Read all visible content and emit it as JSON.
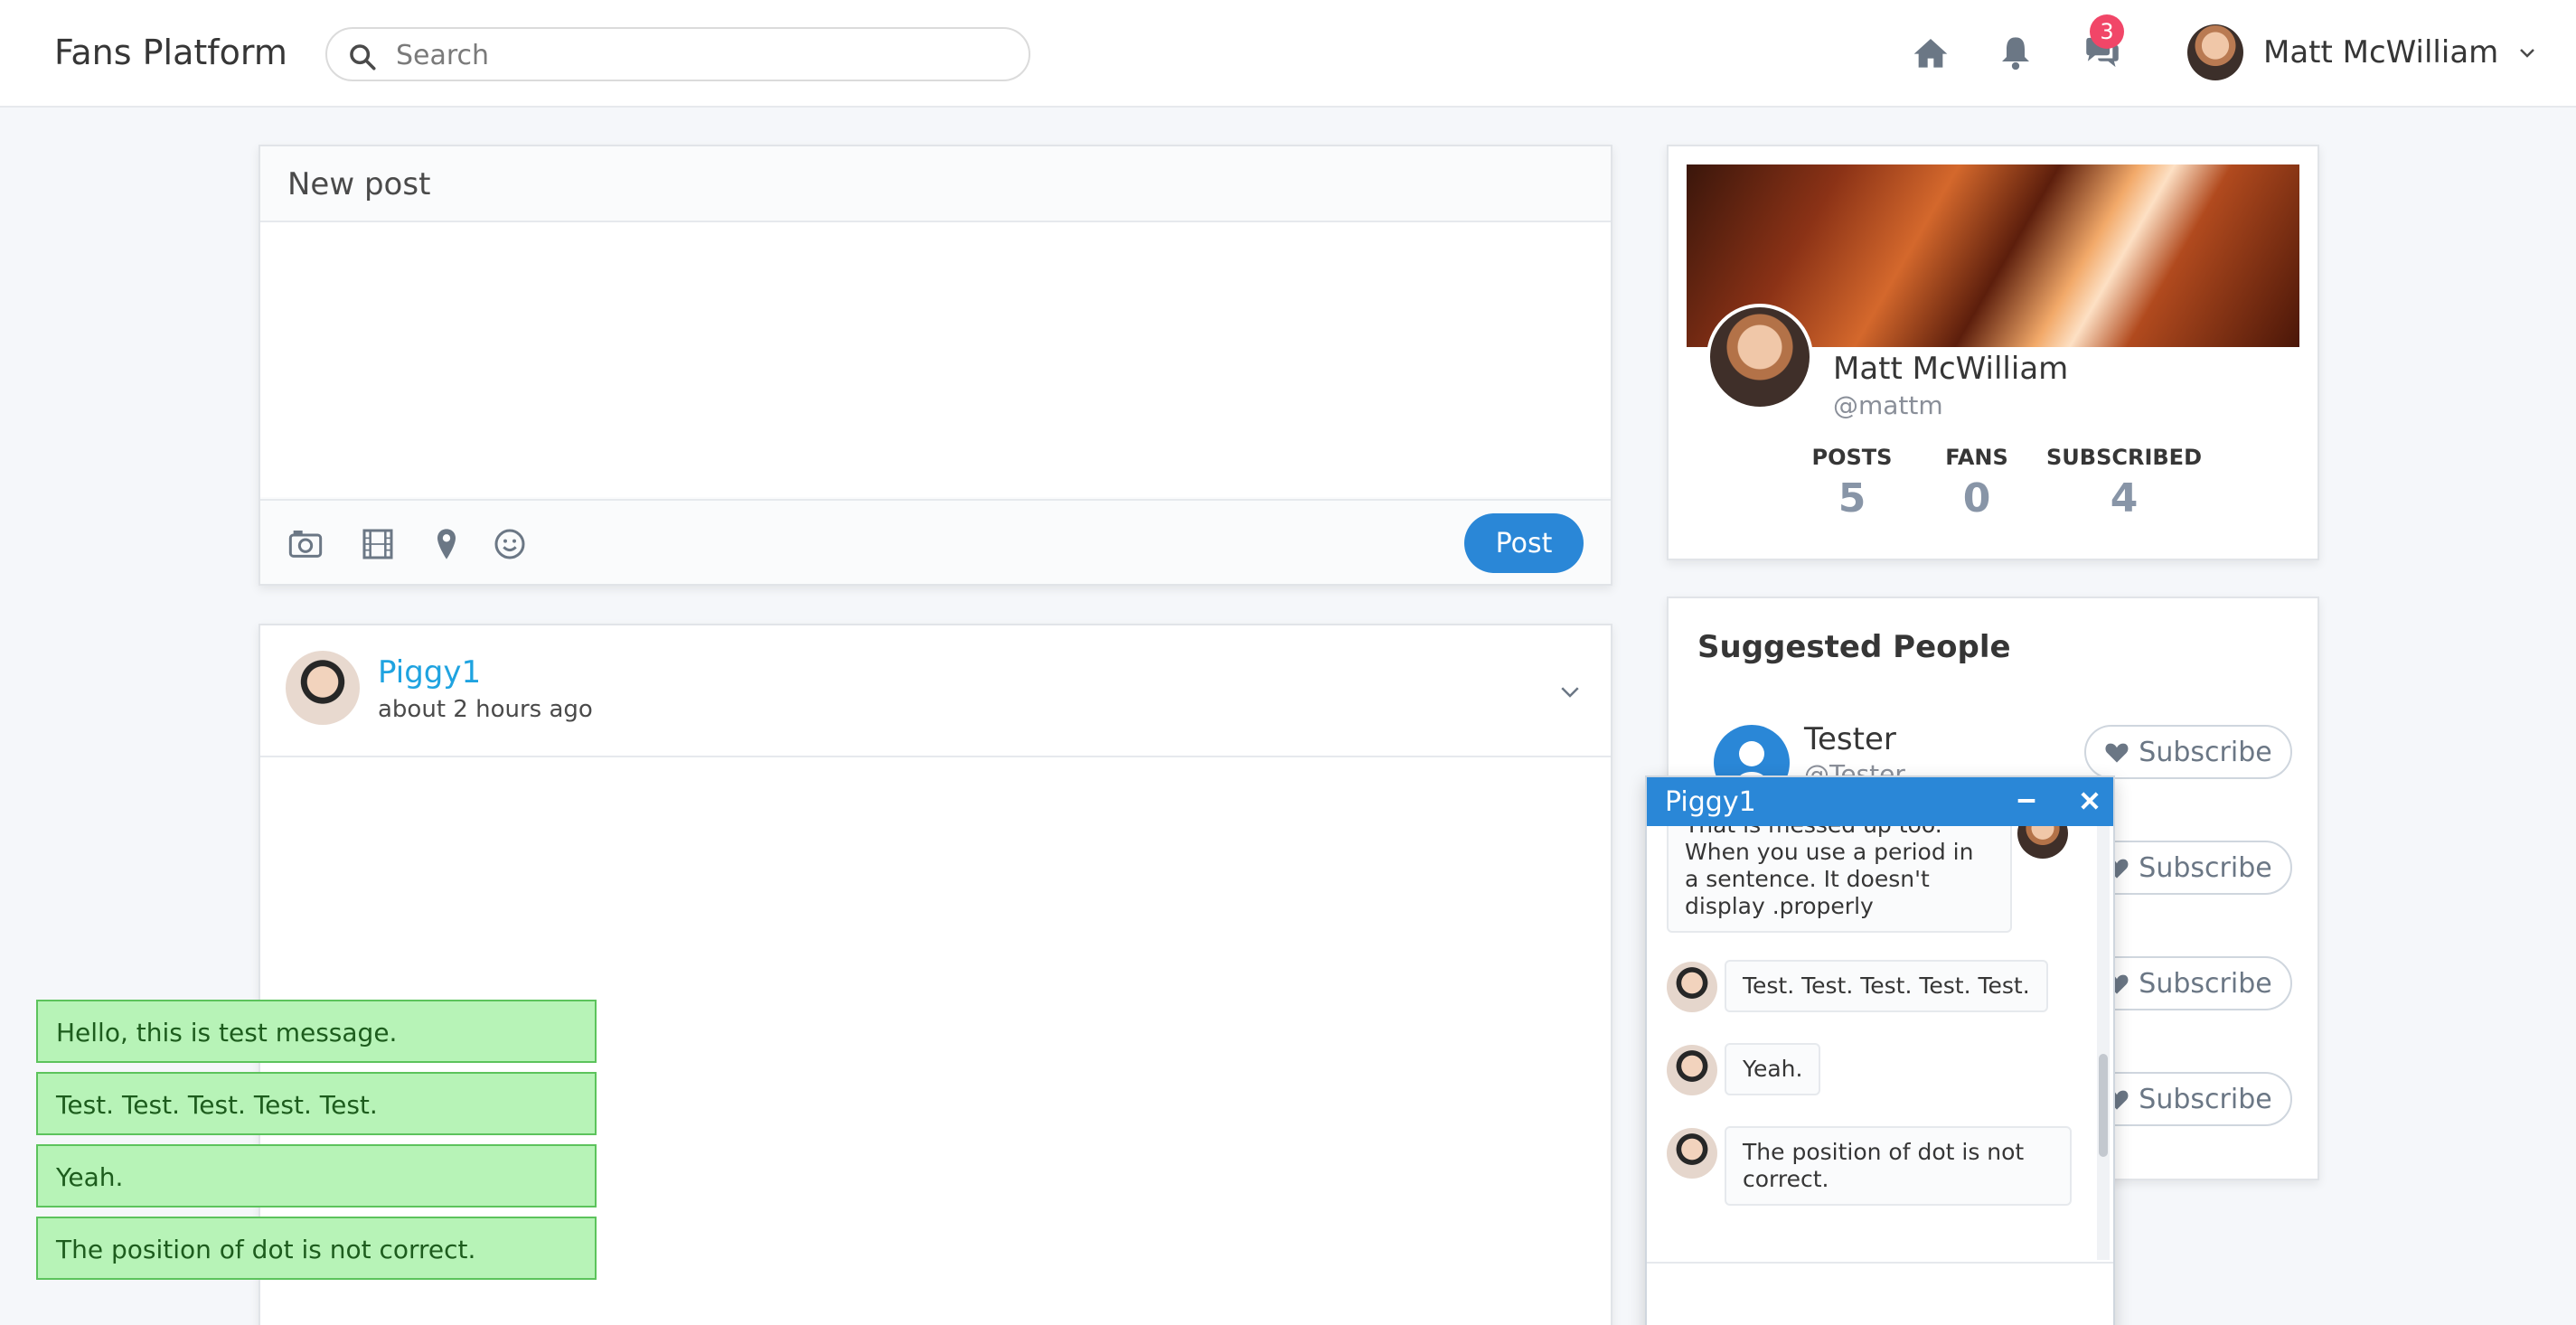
{
  "navbar": {
    "brand": "Fans Platform",
    "search_placeholder": "Search",
    "messages_badge": "3",
    "user_name": "Matt McWilliam",
    "icons": [
      "home-icon",
      "bell-icon",
      "chat-icon",
      "chevron-down-icon"
    ]
  },
  "new_post": {
    "title": "New post",
    "post_label": "Post",
    "tools": [
      "camera-icon",
      "film-icon",
      "location-pin-icon",
      "smiley-icon"
    ]
  },
  "feed_post": {
    "author": "Piggy1",
    "time": "about 2 hours ago"
  },
  "profile": {
    "name": "Matt McWilliam",
    "handle": "@mattm",
    "stats": [
      {
        "label": "POSTS",
        "value": "5"
      },
      {
        "label": "FANS",
        "value": "0"
      },
      {
        "label": "SUBSCRIBED",
        "value": "4"
      }
    ]
  },
  "suggested": {
    "title": "Suggested People",
    "people": [
      {
        "name": "Tester",
        "handle": "@Tester"
      }
    ],
    "subscribe_label": "Subscribe"
  },
  "chat": {
    "title": "Piggy1",
    "messages": [
      {
        "text": "That is messed up too. When you use a period in a sentence. It doesn't display .properly",
        "own": true
      },
      {
        "text": "Test. Test. Test. Test. Test.",
        "own": false
      },
      {
        "text": "Yeah.",
        "own": false
      },
      {
        "text": "The position of dot is not correct.",
        "own": false
      }
    ]
  },
  "toasts": [
    "Hello, this is test message.",
    "Test. Test. Test. Test. Test.",
    "Yeah.",
    "The position of dot is not correct."
  ],
  "colors": {
    "accent": "#2a87d7",
    "badge": "#f14668",
    "link": "#1fa3e0",
    "toast_bg": "#b7f3b7"
  }
}
